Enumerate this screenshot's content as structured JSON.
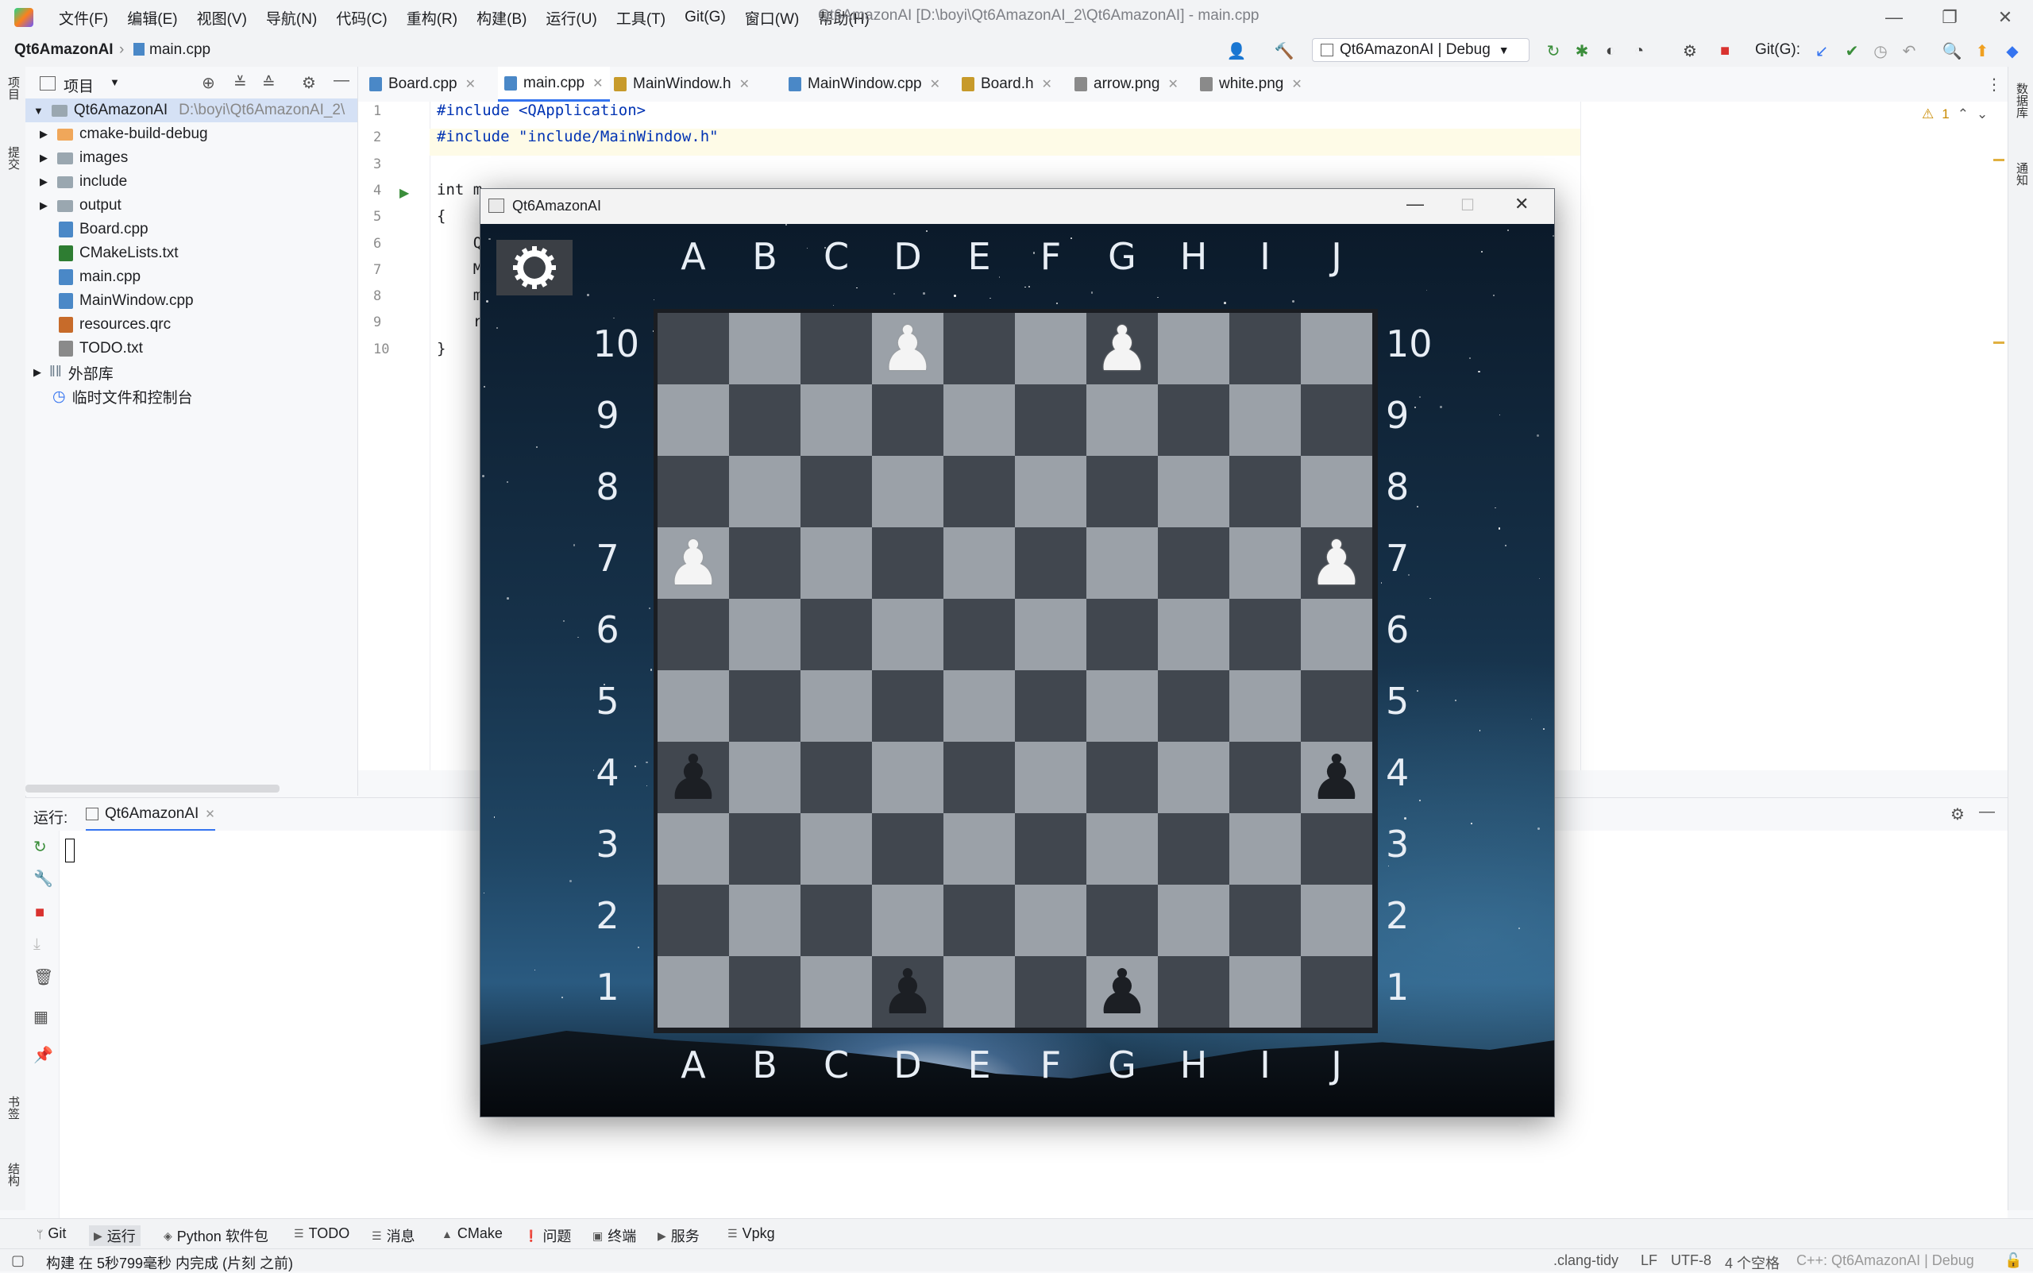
{
  "menu": [
    "文件(F)",
    "编辑(E)",
    "视图(V)",
    "导航(N)",
    "代码(C)",
    "重构(R)",
    "构建(B)",
    "运行(U)",
    "工具(T)",
    "Git(G)",
    "窗口(W)",
    "帮助(H)"
  ],
  "window_title": "Qt6AmazonAI [D:\\boyi\\Qt6AmazonAI_2\\Qt6AmazonAI] - main.cpp",
  "breadcrumb": {
    "project": "Qt6AmazonAI",
    "file": "main.cpp"
  },
  "run_config": "Qt6AmazonAI | Debug",
  "git_label": "Git(G):",
  "left_stripe": {
    "project": "项目",
    "commit": "提交",
    "bookmarks": "书签",
    "structure": "结构"
  },
  "right_stripe": {
    "database": "数据库",
    "notifications": "通知"
  },
  "project_panel": {
    "title": "项目",
    "root": "Qt6AmazonAI",
    "root_path": "D:\\boyi\\Qt6AmazonAI_2\\",
    "items": [
      {
        "label": "cmake-build-debug",
        "type": "folder-orange"
      },
      {
        "label": "images",
        "type": "folder"
      },
      {
        "label": "include",
        "type": "folder"
      },
      {
        "label": "output",
        "type": "folder"
      },
      {
        "label": "Board.cpp",
        "type": "cpp"
      },
      {
        "label": "CMakeLists.txt",
        "type": "cmake"
      },
      {
        "label": "main.cpp",
        "type": "cpp"
      },
      {
        "label": "MainWindow.cpp",
        "type": "cpp"
      },
      {
        "label": "resources.qrc",
        "type": "qrc"
      },
      {
        "label": "TODO.txt",
        "type": "txt"
      }
    ],
    "external": "外部库",
    "scratches": "临时文件和控制台"
  },
  "tabs": [
    {
      "label": "Board.cpp"
    },
    {
      "label": "main.cpp"
    },
    {
      "label": "MainWindow.h"
    },
    {
      "label": "MainWindow.cpp"
    },
    {
      "label": "Board.h"
    },
    {
      "label": "arrow.png"
    },
    {
      "label": "white.png"
    }
  ],
  "warnings": "1",
  "code_lines": [
    {
      "n": "1",
      "text": "#include <QApplication>"
    },
    {
      "n": "2",
      "text": "#include \"include/MainWindow.h\""
    },
    {
      "n": "3",
      "text": ""
    },
    {
      "n": "4",
      "text": "int m"
    },
    {
      "n": "5",
      "text": "{"
    },
    {
      "n": "6",
      "text": "    Q"
    },
    {
      "n": "7",
      "text": "    M"
    },
    {
      "n": "8",
      "text": "    m"
    },
    {
      "n": "9",
      "text": "    r"
    },
    {
      "n": "10",
      "text": "}"
    }
  ],
  "run_panel": {
    "label": "运行:",
    "config": "Qt6AmazonAI"
  },
  "toolwindows": [
    "Git",
    "运行",
    "Python 软件包",
    "TODO",
    "消息",
    "CMake",
    "问题",
    "终端",
    "服务",
    "Vpkg"
  ],
  "status": {
    "message": "构建 在 5秒799毫秒 内完成 (片刻 之前)",
    "linter": ".clang-tidy",
    "line_sep": "LF",
    "encoding": "UTF-8",
    "indent": "4 个空格",
    "context": "C++: Qt6AmazonAI | Debug"
  },
  "app_window": {
    "title": "Qt6AmazonAI",
    "columns": [
      "A",
      "B",
      "C",
      "D",
      "E",
      "F",
      "G",
      "H",
      "I",
      "J"
    ],
    "rows": [
      "10",
      "9",
      "8",
      "7",
      "6",
      "5",
      "4",
      "3",
      "2",
      "1"
    ],
    "pieces": [
      {
        "color": "white",
        "square": "D10"
      },
      {
        "color": "white",
        "square": "G10"
      },
      {
        "color": "white",
        "square": "A7"
      },
      {
        "color": "white",
        "square": "J7"
      },
      {
        "color": "black",
        "square": "A4"
      },
      {
        "color": "black",
        "square": "J4"
      },
      {
        "color": "black",
        "square": "D1"
      },
      {
        "color": "black",
        "square": "G1"
      }
    ]
  }
}
